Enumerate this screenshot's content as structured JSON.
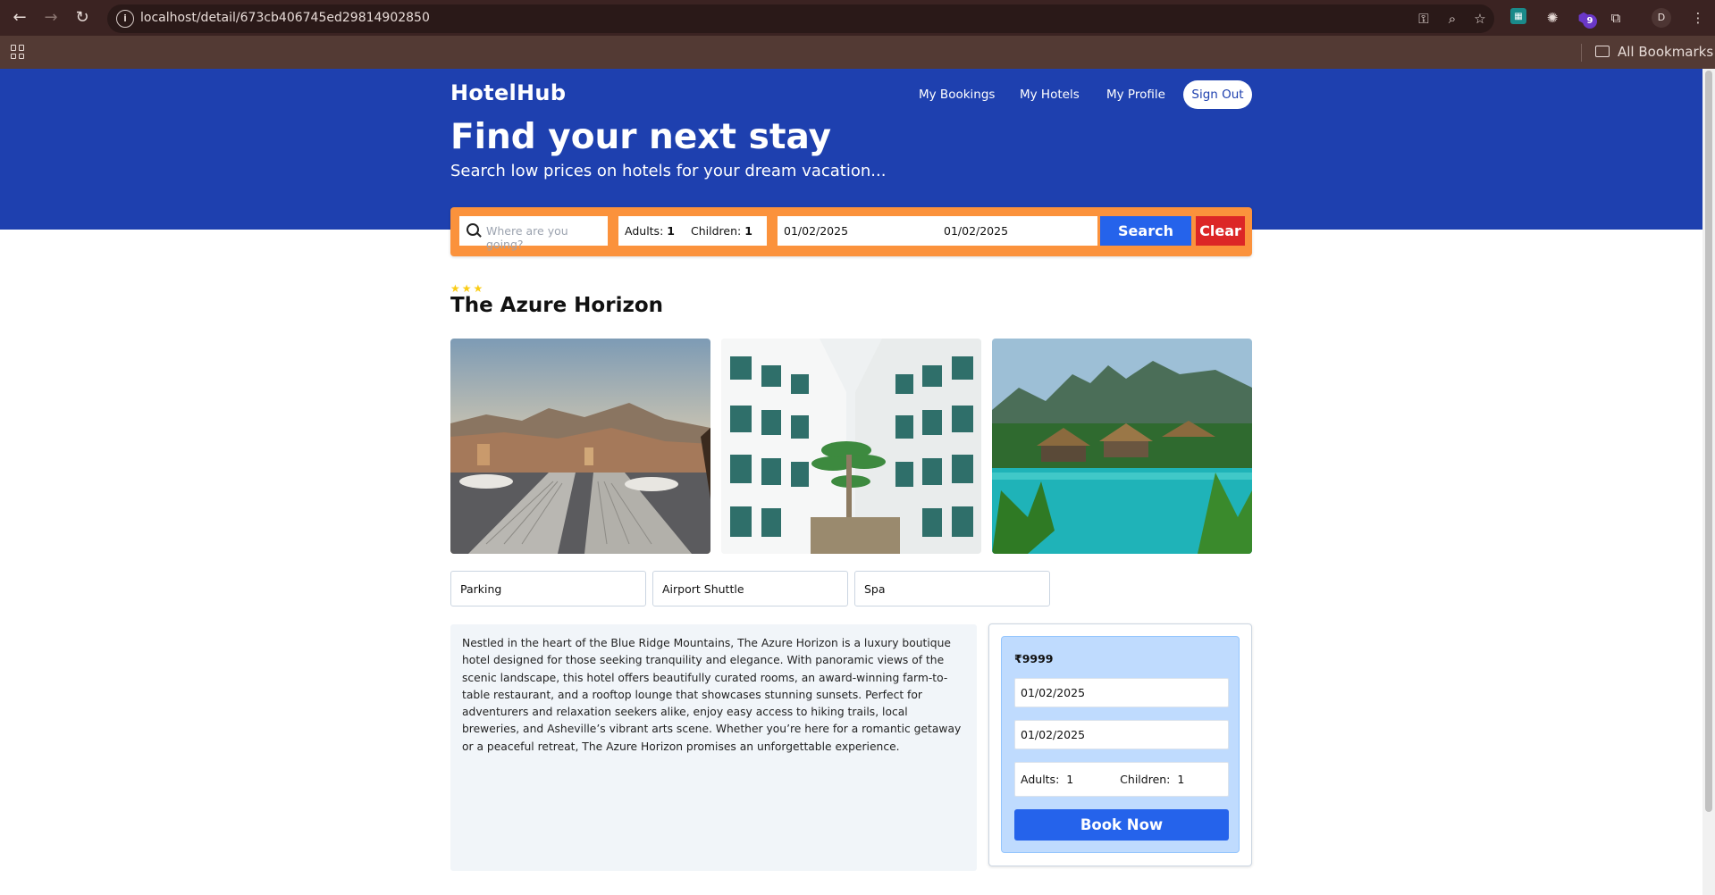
{
  "browser": {
    "url": "localhost/detail/673cb406745ed29814902850",
    "extension_badge": "9",
    "profile_initial": "D",
    "bookmarks_label": "All Bookmarks"
  },
  "header": {
    "brand": "HotelHub",
    "nav": {
      "bookings": "My Bookings",
      "hotels": "My Hotels",
      "profile": "My Profile",
      "sign_out": "Sign Out"
    },
    "title": "Find your next stay",
    "subtitle": "Search low prices on hotels for your dream vacation..."
  },
  "search": {
    "destination_placeholder": "Where are you going?",
    "adults_label": "Adults:",
    "adults_value": "1",
    "children_label": "Children:",
    "children_value": "1",
    "check_in": "01/02/2025",
    "check_out": "01/02/2025",
    "search_label": "Search",
    "clear_label": "Clear"
  },
  "hotel": {
    "star_rating": 3,
    "stars_text": "★★★",
    "name": "The Azure Horizon",
    "images": [
      "mountain-rooftop-lounge",
      "white-hotel-courtyard-palms",
      "tropical-pool-huts"
    ],
    "facilities": [
      "Parking",
      "Airport Shuttle",
      "Spa"
    ],
    "description": "Nestled in the heart of the Blue Ridge Mountains, The Azure Horizon is a luxury boutique hotel designed for those seeking tranquility and elegance. With panoramic views of the scenic landscape, this hotel offers beautifully curated rooms, an award-winning farm-to-table restaurant, and a rooftop lounge that showcases stunning sunsets. Perfect for adventurers and relaxation seekers alike, enjoy easy access to hiking trails, local breweries, and Asheville’s vibrant arts scene. Whether you’re here for a romantic getaway or a peaceful retreat, The Azure Horizon promises an unforgettable experience."
  },
  "booking": {
    "price": "₹9999",
    "check_in": "01/02/2025",
    "check_out": "01/02/2025",
    "adults_label": "Adults:",
    "adults_value": "1",
    "children_label": "Children:",
    "children_value": "1",
    "book_label": "Book Now"
  },
  "colors": {
    "hero": "#1e40af",
    "search_frame": "#fb923c",
    "search_button": "#2563eb",
    "clear_button": "#dc2626",
    "booking_panel": "#bfdbfe",
    "star": "#facc15"
  }
}
